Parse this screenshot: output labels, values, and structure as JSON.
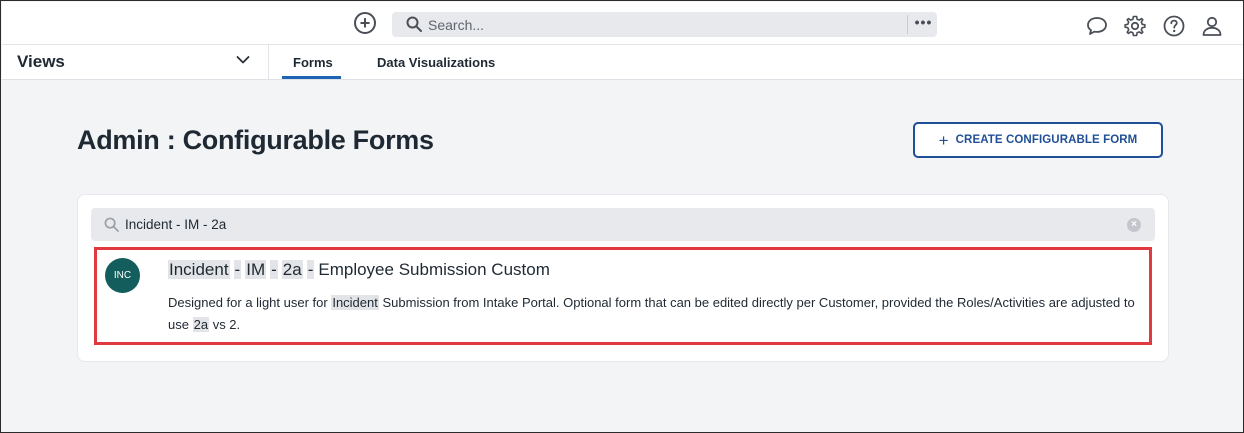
{
  "topbar": {
    "search_placeholder": "Search...",
    "more_label": "•••"
  },
  "nav": {
    "views_label": "Views",
    "tabs": [
      {
        "label": "Forms",
        "active": true
      },
      {
        "label": "Data Visualizations",
        "active": false
      }
    ]
  },
  "page": {
    "title": "Admin : Configurable Forms",
    "create_button_plus": "+",
    "create_button_label": "CREATE CONFIGURABLE FORM"
  },
  "filter": {
    "query": "Incident - IM - 2a",
    "clear_label": "×"
  },
  "result": {
    "avatar": "INC",
    "title_parts": {
      "w1": "Incident",
      "sep1": "-",
      "w2": "IM",
      "sep2": "-",
      "w3": "2a",
      "sep3": "-",
      "rest": "Employee Submission Custom"
    },
    "desc_parts": {
      "pre": "Designed for a light user for",
      "hl1": "Incident",
      "mid": "Submission from Intake Portal. Optional form that can be edited directly per Customer, provided the Roles/Activities are adjusted to use",
      "hl2": "2a",
      "post": "vs 2."
    }
  },
  "colors": {
    "accent": "#1f63b5",
    "button_border": "#1f4f96",
    "avatar_bg": "#135e5d",
    "highlight_border": "#e0393e"
  }
}
